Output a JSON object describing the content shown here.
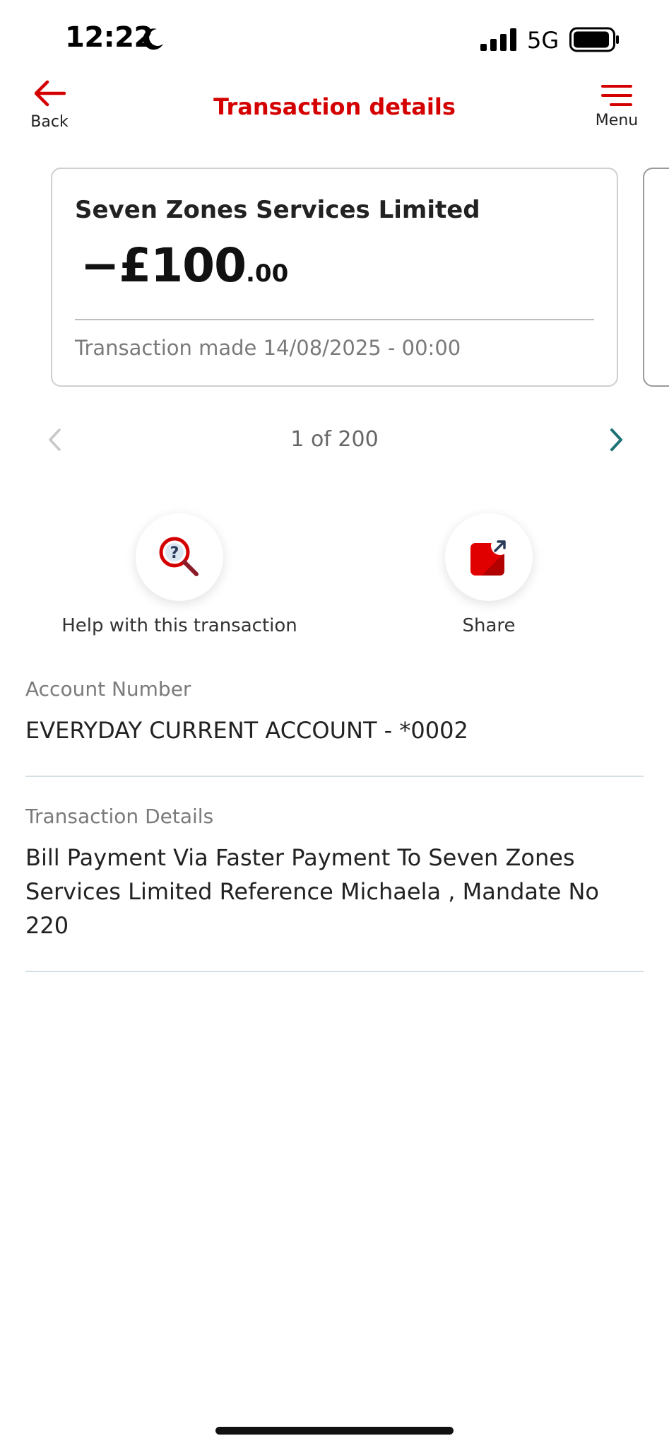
{
  "status_bar": {
    "time": "12:22",
    "network": "5G",
    "icons": [
      "moon-icon",
      "signal-icon",
      "battery-icon"
    ]
  },
  "header": {
    "back_label": "Back",
    "title": "Transaction details",
    "menu_label": "Menu",
    "icons": [
      "arrow-left-icon",
      "hamburger-menu-icon"
    ]
  },
  "transaction": {
    "merchant": "Seven Zones Services Limited",
    "amount_main": "−£100",
    "amount_pence": ".00",
    "date_text": "Transaction made 14/08/2025 - 00:00"
  },
  "pager": {
    "text": "1 of 200",
    "icons": [
      "chevron-left-icon",
      "chevron-right-icon"
    ]
  },
  "actions": {
    "help_label": "Help with this transaction",
    "share_label": "Share",
    "icons": [
      "help-search-icon",
      "share-icon"
    ]
  },
  "account": {
    "label": "Account Number",
    "value": "EVERYDAY CURRENT ACCOUNT - *0002"
  },
  "details": {
    "label": "Transaction Details",
    "value": "Bill Payment Via Faster Payment To Seven Zones Services Limited Reference Michaela , Mandate No 220"
  },
  "colors": {
    "brand_red": "#d40000",
    "teal_accent": "#1d7373",
    "muted_text": "#7a7a7a"
  }
}
